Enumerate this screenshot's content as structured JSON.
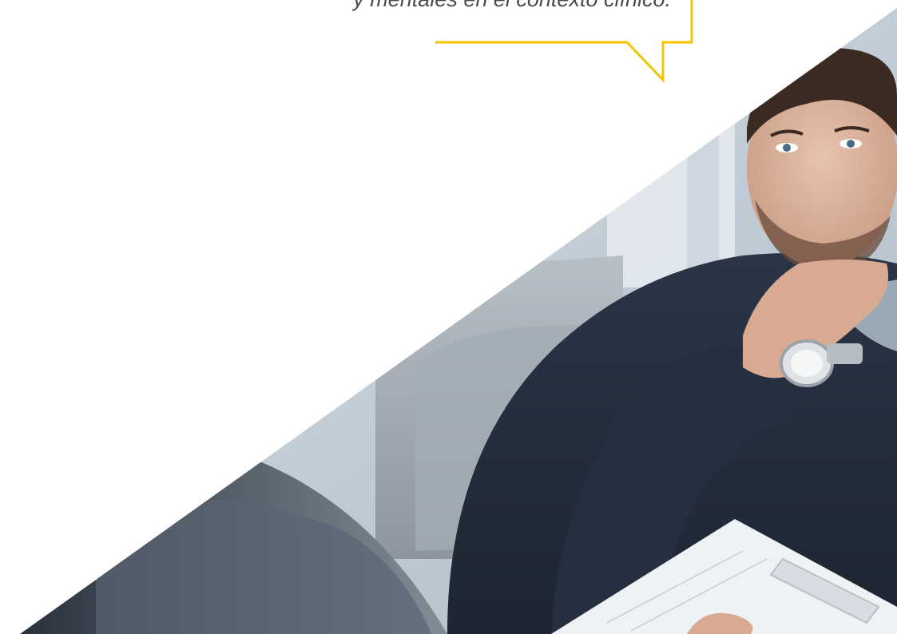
{
  "quote": {
    "text": "y mentales en el contexto clínico."
  },
  "colors": {
    "accent": "#f2c500",
    "background": "#ffffff",
    "text": "#4b4b4b"
  },
  "photo": {
    "icon": "consultation-photo"
  }
}
